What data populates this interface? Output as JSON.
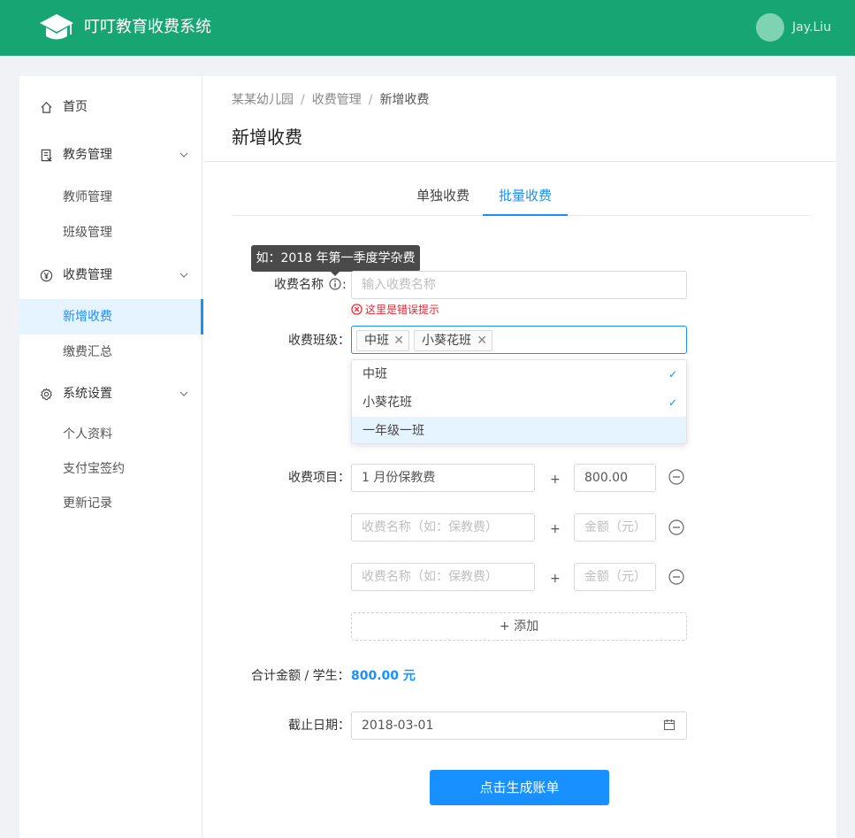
{
  "header": {
    "app_title": "叮叮教育收费系统",
    "username": "Jay.Liu"
  },
  "sidebar": {
    "home": "首页",
    "academic": {
      "label": "教务管理",
      "items": [
        "教师管理",
        "班级管理"
      ]
    },
    "fees": {
      "label": "收费管理",
      "items": [
        "新增收费",
        "缴费汇总"
      ]
    },
    "settings": {
      "label": "系统设置",
      "items": [
        "个人资料",
        "支付宝签约",
        "更新记录"
      ]
    }
  },
  "breadcrumb": [
    "某某幼儿园",
    "收费管理",
    "新增收费"
  ],
  "page_title": "新增收费",
  "tabs": [
    "单独收费",
    "批量收费"
  ],
  "form": {
    "tooltip": "如：2018 年第一季度学杂费",
    "fee_name": {
      "label": "收费名称",
      "colon": ":",
      "placeholder": "输入收费名称",
      "error": "这里是错误提示"
    },
    "classes": {
      "label": "收费班级：",
      "tags": [
        "中班",
        "小葵花班"
      ],
      "options": [
        {
          "label": "中班",
          "check": "✓"
        },
        {
          "label": "小葵花班",
          "check": "✓"
        },
        {
          "label": "一年级一班",
          "check": ""
        }
      ]
    },
    "items": {
      "label": "收费项目：",
      "plus": "+",
      "rows": [
        {
          "name": "1 月份保教费",
          "amount": "800.00"
        },
        {
          "name": "",
          "amount": ""
        },
        {
          "name": "",
          "amount": ""
        }
      ],
      "name_placeholder": "收费名称（如：保教费）",
      "amount_placeholder": "金额（元）"
    },
    "add_label": "+  添加",
    "total": {
      "label": "合计金额 / 学生：",
      "value": "800.00 元"
    },
    "deadline": {
      "label": "截止日期：",
      "value": "2018-03-01"
    },
    "submit_label": "点击生成账单"
  },
  "colors": {
    "header": "#17a673",
    "primary": "#1890ff",
    "error": "#f5222d"
  }
}
